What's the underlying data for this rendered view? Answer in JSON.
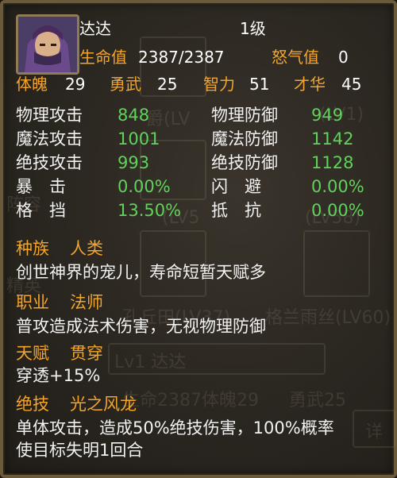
{
  "character": {
    "name": "达达",
    "level": "1级",
    "hp_label": "生命值",
    "hp_value": "2387/2387",
    "rage_label": "怒气值",
    "rage_value": "0"
  },
  "base_stats": [
    {
      "label": "体魄",
      "value": "29"
    },
    {
      "label": "勇武",
      "value": "25"
    },
    {
      "label": "智力",
      "value": "51"
    },
    {
      "label": "才华",
      "value": "45"
    }
  ],
  "combat_stats": [
    {
      "left_label": "物理攻击",
      "left_value": "848",
      "right_label": "物理防御",
      "right_value": "949"
    },
    {
      "left_label": "魔法攻击",
      "left_value": "1001",
      "right_label": "魔法防御",
      "right_value": "1142"
    },
    {
      "left_label": "绝技攻击",
      "left_value": "993",
      "right_label": "绝技防御",
      "right_value": "1128"
    },
    {
      "left_label": "暴　击",
      "left_value": "0.00%",
      "right_label": "闪　避",
      "right_value": "0.00%"
    },
    {
      "left_label": "格　挡",
      "left_value": "13.50%",
      "right_label": "抵　抗",
      "right_value": "0.00%"
    }
  ],
  "race": {
    "header": "种族",
    "name": "人类",
    "desc": "创世神界的宠儿，寿命短暂天赋多"
  },
  "job": {
    "header": "职业",
    "name": "法师",
    "desc": "普攻造成法术伤害，无视物理防御"
  },
  "talent": {
    "header": "天赋",
    "name": "贯穿",
    "desc": "穿透+15%"
  },
  "skill": {
    "header": "绝技",
    "name": "光之风龙",
    "desc_line1": "单体攻击，造成50%绝技伤害，100%概率",
    "desc_line2": "使目标失明1回合"
  },
  "background_ui": {
    "ghost1": "爵(LV",
    "ghost2": "(LV1)",
    "ghost3": "(LV5",
    "ghost4": "(LV58)",
    "ghost5": "孔丘田(LV37)",
    "ghost6": "格兰雨丝(LV60)",
    "ghost7": "Lv1 达达",
    "ghost8": "生命2387",
    "ghost9": "体魄29",
    "ghost10": "勇武25",
    "ghost11": "详",
    "ghost12": "阵容",
    "ghost13": "精英"
  },
  "colors": {
    "accent_label": "#f3a52c",
    "stat_value": "#5fd35a",
    "frame": "#6b5a3a"
  }
}
